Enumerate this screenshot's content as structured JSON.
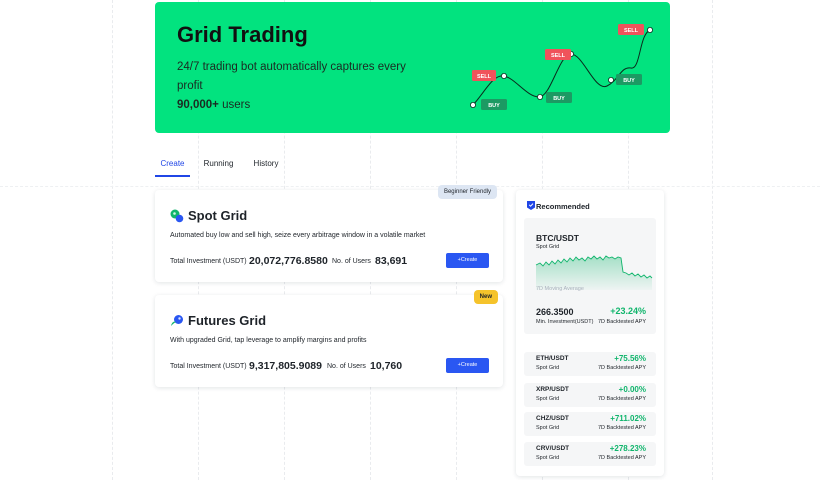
{
  "banner": {
    "title": "Grid Trading",
    "subtitle": "24/7 trading bot automatically captures every profit",
    "users_count": "90,000+",
    "users_label": "users",
    "sell_label": "SELL",
    "buy_label": "BUY"
  },
  "tabs": [
    {
      "label": "Create",
      "active": true
    },
    {
      "label": "Running",
      "active": false
    },
    {
      "label": "History",
      "active": false
    }
  ],
  "cards": {
    "spot": {
      "title": "Spot Grid",
      "badge": "Beginner Friendly",
      "description": "Automated buy low and sell high, seize every arbitrage window in a volatile market",
      "investment_label": "Total Investment (USDT)",
      "investment_value": "20,072,776.8580",
      "users_label": "No. of Users",
      "users_value": "83,691",
      "create_label": "+Create"
    },
    "futures": {
      "title": "Futures Grid",
      "badge": "New",
      "description": "With upgraded Grid, tap leverage to amplify margins and profits",
      "investment_label": "Total Investment (USDT)",
      "investment_value": "9,317,805.9089",
      "users_label": "No. of Users",
      "users_value": "10,760",
      "create_label": "+Create"
    }
  },
  "recommended": {
    "title": "Recommended",
    "featured": {
      "pair": "BTC/USDT",
      "type": "Spot Grid",
      "chart_caption": "7D Moving Average",
      "price": "266.3500",
      "min_label": "Min. Investment(USDT)",
      "apy": "+23.24%",
      "apy_label": "7D Backtested APY"
    },
    "items": [
      {
        "pair": "ETH/USDT",
        "type": "Spot Grid",
        "apy": "+75.56%",
        "apy_label": "7D Backtested APY"
      },
      {
        "pair": "XRP/USDT",
        "type": "Spot Grid",
        "apy": "+0.00%",
        "apy_label": "7D Backtested APY"
      },
      {
        "pair": "CHZ/USDT",
        "type": "Spot Grid",
        "apy": "+711.02%",
        "apy_label": "7D Backtested APY"
      },
      {
        "pair": "CRV/USDT",
        "type": "Spot Grid",
        "apy": "+278.23%",
        "apy_label": "7D Backtested APY"
      }
    ]
  },
  "colors": {
    "banner_bg": "#02e37f",
    "accent_blue": "#2046e6",
    "button_blue": "#2a57f2",
    "positive_green": "#10b56c",
    "sell_red": "#f0535b",
    "buy_green": "#1c9a63",
    "new_badge": "#f5c32b"
  },
  "icons": {
    "spot": "spot-grid-icon",
    "futures": "futures-grid-icon",
    "recommended": "recommended-badge-icon"
  }
}
